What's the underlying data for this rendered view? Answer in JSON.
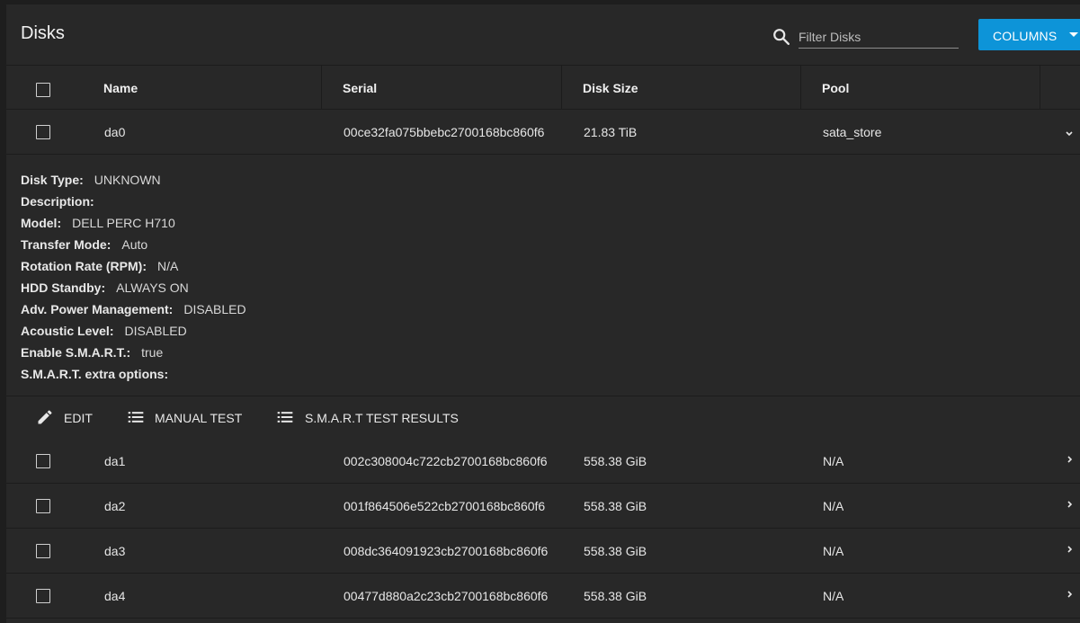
{
  "header": {
    "title": "Disks",
    "filter_placeholder": "Filter Disks",
    "columns_label": "COLUMNS"
  },
  "table": {
    "columns": [
      "Name",
      "Serial",
      "Disk Size",
      "Pool"
    ],
    "rows": [
      {
        "name": "da0",
        "serial": "00ce32fa075bbebc2700168bc860f6",
        "size": "21.83 TiB",
        "pool": "sata_store"
      },
      {
        "name": "da1",
        "serial": "002c308004c722cb2700168bc860f6",
        "size": "558.38 GiB",
        "pool": "N/A"
      },
      {
        "name": "da2",
        "serial": "001f864506e522cb2700168bc860f6",
        "size": "558.38 GiB",
        "pool": "N/A"
      },
      {
        "name": "da3",
        "serial": "008dc364091923cb2700168bc860f6",
        "size": "558.38 GiB",
        "pool": "N/A"
      },
      {
        "name": "da4",
        "serial": "00477d880a2c23cb2700168bc860f6",
        "size": "558.38 GiB",
        "pool": "N/A"
      }
    ]
  },
  "details": [
    {
      "key": "Disk Type:",
      "value": "UNKNOWN"
    },
    {
      "key": "Description:",
      "value": ""
    },
    {
      "key": "Model:",
      "value": "DELL PERC H710"
    },
    {
      "key": "Transfer Mode:",
      "value": "Auto"
    },
    {
      "key": "Rotation Rate (RPM):",
      "value": "N/A"
    },
    {
      "key": "HDD Standby:",
      "value": "ALWAYS ON"
    },
    {
      "key": "Adv. Power Management:",
      "value": "DISABLED"
    },
    {
      "key": "Acoustic Level:",
      "value": "DISABLED"
    },
    {
      "key": "Enable S.M.A.R.T.:",
      "value": "true"
    },
    {
      "key": "S.M.A.R.T. extra options:",
      "value": ""
    }
  ],
  "actions": {
    "edit": "EDIT",
    "manual_test": "MANUAL TEST",
    "smart_results": "S.M.A.R.T TEST RESULTS"
  },
  "colors": {
    "accent": "#0d94d8",
    "background": "#1e1e1e",
    "card": "#282828"
  }
}
